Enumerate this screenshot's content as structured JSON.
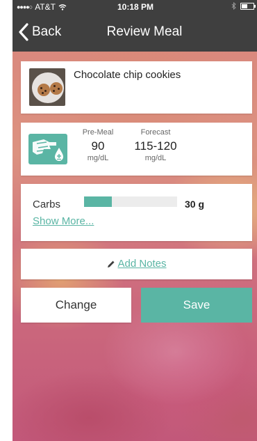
{
  "status_bar": {
    "carrier": "AT&T",
    "time": "10:18 PM"
  },
  "nav": {
    "back_label": "Back",
    "title": "Review Meal"
  },
  "meal": {
    "name": "Chocolate chip cookies"
  },
  "glucose": {
    "premeal_label": "Pre-Meal",
    "premeal_value": "90",
    "premeal_unit": "mg/dL",
    "forecast_label": "Forecast",
    "forecast_value": "115-120",
    "forecast_unit": "mg/dL"
  },
  "carbs": {
    "label": "Carbs",
    "value": "30 g",
    "bar_fraction": 0.3,
    "show_more": "Show More..."
  },
  "notes": {
    "add_label": "Add Notes"
  },
  "actions": {
    "change_label": "Change",
    "save_label": "Save"
  },
  "colors": {
    "accent": "#5ab5a4",
    "bar_background": "#3f3f3f"
  },
  "icons": [
    "wifi-icon",
    "bluetooth-icon",
    "battery-icon",
    "back-chevron-icon",
    "glucose-meter-icon",
    "pencil-icon"
  ]
}
